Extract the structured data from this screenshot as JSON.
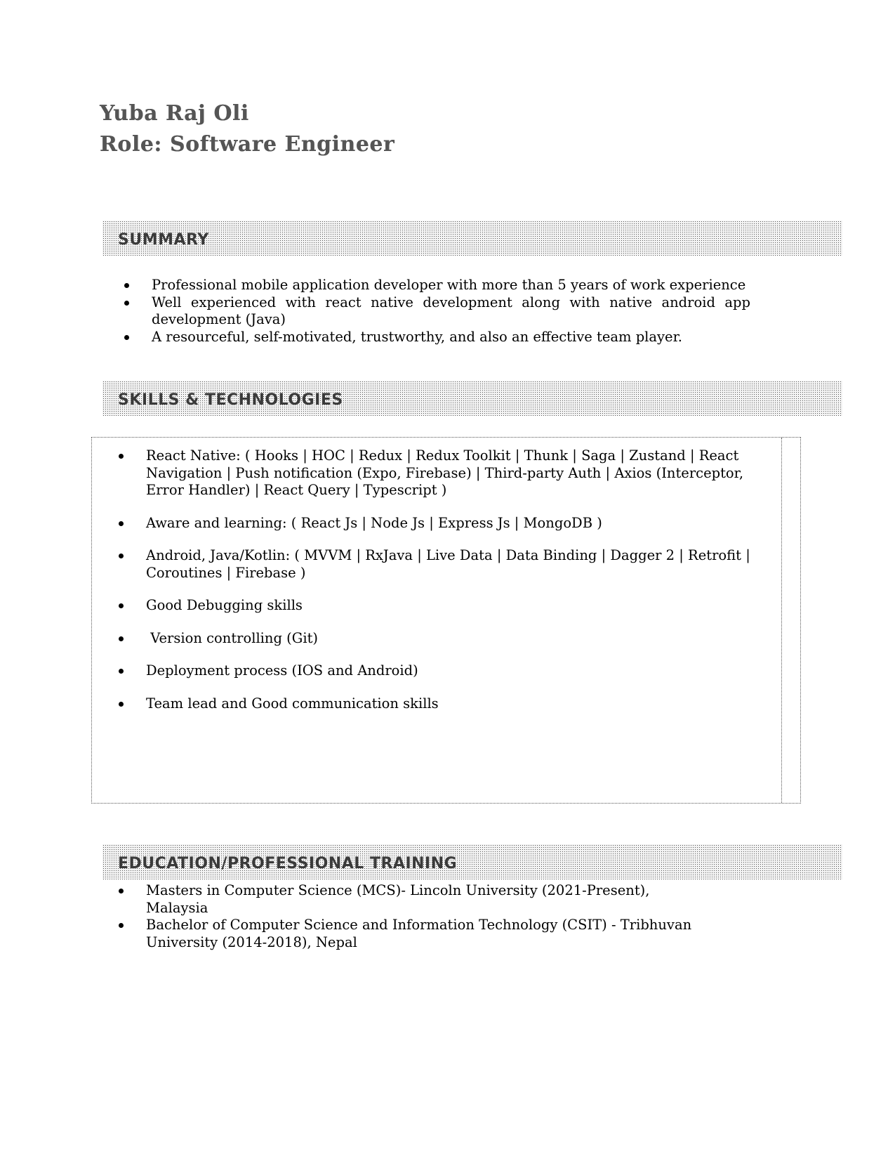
{
  "header": {
    "name": "Yuba Raj Oli",
    "role": "Role: Software Engineer"
  },
  "summary": {
    "title": "SUMMARY",
    "items": [
      "Professional mobile application developer with more than 5 years of work experience",
      "Well experienced with react native development along with native android app development (Java)",
      "A resourceful, self-motivated, trustworthy, and also an effective team player."
    ]
  },
  "skills": {
    "title": "SKILLS & TECHNOLOGIES",
    "items": [
      "React Native: ( Hooks | HOC | Redux | Redux Toolkit | Thunk | Saga | Zustand | React Navigation | Push notification (Expo, Firebase) | Third-party Auth | Axios (Interceptor, Error Handler) | React Query | Typescript )",
      "Aware and learning: ( React Js | Node Js | Express Js | MongoDB )",
      "Android, Java/Kotlin: ( MVVM | RxJava | Live Data | Data Binding | Dagger 2 | Retrofit | Coroutines | Firebase )",
      "Good Debugging skills",
      " Version controlling (Git)",
      "Deployment process (IOS and Android)",
      "Team lead and Good communication skills"
    ]
  },
  "education": {
    "title": "EDUCATION/PROFESSIONAL TRAINING",
    "items": [
      "Masters in Computer Science (MCS)- Lincoln University (2021-Present), Malaysia",
      "Bachelor of Computer Science and Information Technology (CSIT) - Tribhuvan University (2014-2018), Nepal"
    ]
  }
}
